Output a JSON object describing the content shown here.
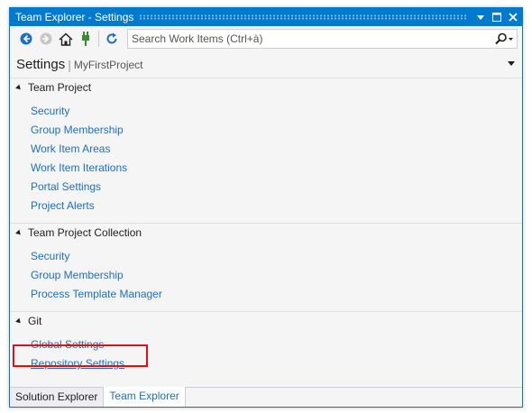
{
  "window": {
    "title": "Team Explorer - Settings",
    "accent_color": "#007acc",
    "buttons": [
      "dropdown-icon",
      "maximize-icon",
      "close-icon"
    ]
  },
  "toolbar": {
    "icons": [
      "back-icon",
      "forward-icon",
      "home-icon",
      "connect-icon",
      "refresh-icon"
    ],
    "search_placeholder": "Search Work Items (Ctrl+à)"
  },
  "header": {
    "title": "Settings",
    "separator": "|",
    "project": "MyFirstProject"
  },
  "sections": [
    {
      "title": "Team Project",
      "links": [
        "Security",
        "Group Membership",
        "Work Item Areas",
        "Work Item Iterations",
        "Portal Settings",
        "Project Alerts"
      ]
    },
    {
      "title": "Team Project Collection",
      "links": [
        "Security",
        "Group Membership",
        "Process Template Manager"
      ]
    },
    {
      "title": "Git",
      "links": [
        "Global Settings",
        "Repository Settings"
      ]
    }
  ],
  "highlight": {
    "target": "Repository Settings",
    "color": "#e01010"
  },
  "tabs": [
    {
      "label": "Solution Explorer",
      "active": false
    },
    {
      "label": "Team Explorer",
      "active": true
    }
  ]
}
